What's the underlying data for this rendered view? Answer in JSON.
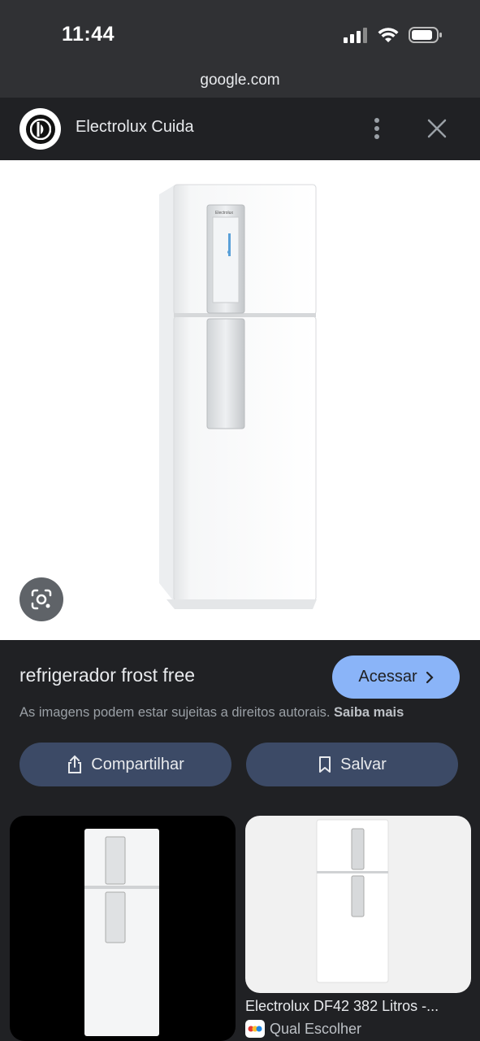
{
  "status_bar": {
    "time": "11:44"
  },
  "browser": {
    "url": "google.com"
  },
  "header": {
    "title": "Electrolux Cuida",
    "logo": "electrolux-logo",
    "more_icon": "more-vert-icon",
    "close_icon": "close-icon"
  },
  "main_image": {
    "brand_text": "Electrolux"
  },
  "details": {
    "title": "refrigerador frost free",
    "visit_label": "Acessar",
    "copyright_text": "As imagens podem estar sujeitas a direitos autorais.",
    "learn_more": "Saiba mais"
  },
  "actions": {
    "share_label": "Compartilhar",
    "save_label": "Salvar"
  },
  "related": [
    {
      "title": "",
      "source": ""
    },
    {
      "title": "Electrolux DF42 382 Litros -...",
      "source": "Qual Escolher"
    }
  ],
  "colors": {
    "accent": "#8ab4f8",
    "button_bg": "#3c4a66",
    "background": "#202124"
  }
}
